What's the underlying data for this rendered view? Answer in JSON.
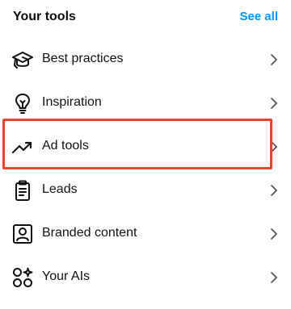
{
  "header": {
    "title": "Your tools",
    "see_all_label": "See all"
  },
  "tools": [
    {
      "label": "Best practices",
      "icon": "graduation-cap-icon"
    },
    {
      "label": "Inspiration",
      "icon": "lightbulb-icon"
    },
    {
      "label": "Ad tools",
      "icon": "trending-up-icon",
      "highlighted": true
    },
    {
      "label": "Leads",
      "icon": "clipboard-icon"
    },
    {
      "label": "Branded content",
      "icon": "branded-content-icon"
    },
    {
      "label": "Your AIs",
      "icon": "ai-sparkle-icon"
    }
  ],
  "colors": {
    "accent": "#0095f6",
    "highlight_border": "#e8452c",
    "text": "#111111",
    "chevron": "#555555"
  }
}
